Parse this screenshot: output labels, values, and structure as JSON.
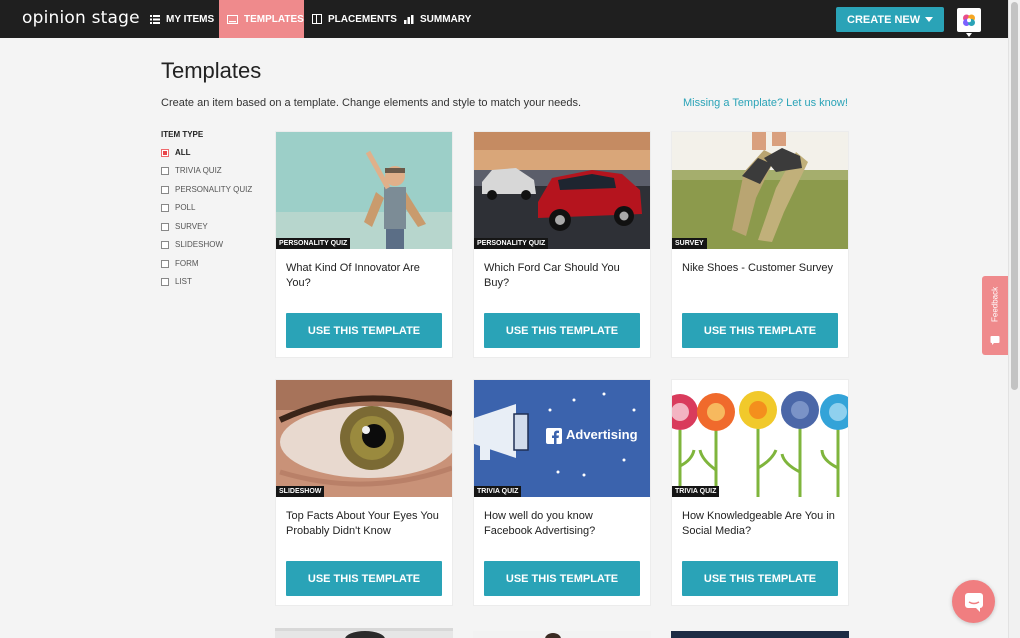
{
  "nav": {
    "logo": "opinion stage",
    "items": [
      {
        "label": "My Items",
        "icon": "list-icon"
      },
      {
        "label": "Templates",
        "icon": "template-icon"
      },
      {
        "label": "Placements",
        "icon": "placement-icon"
      },
      {
        "label": "Summary",
        "icon": "bar-chart-icon"
      }
    ],
    "create_new": "CREATE NEW"
  },
  "page": {
    "title": "Templates",
    "subtitle": "Create an item based on a template. Change elements and style to match your needs.",
    "missing_link": "Missing a Template? Let us know!"
  },
  "filters": {
    "heading": "ITEM TYPE",
    "items": [
      "ALL",
      "TRIVIA QUIZ",
      "PERSONALITY QUIZ",
      "POLL",
      "SURVEY",
      "SLIDESHOW",
      "FORM",
      "LIST"
    ],
    "selected": "ALL"
  },
  "cards": [
    {
      "tag": "PERSONALITY QUIZ",
      "title": "What Kind Of Innovator Are You?",
      "button": "USE THIS TEMPLATE"
    },
    {
      "tag": "PERSONALITY QUIZ",
      "title": "Which Ford Car Should You Buy?",
      "button": "USE THIS TEMPLATE"
    },
    {
      "tag": "SURVEY",
      "title": "Nike Shoes - Customer Survey",
      "button": "USE THIS TEMPLATE"
    },
    {
      "tag": "SLIDESHOW",
      "title": "Top Facts About Your Eyes You Probably Didn't Know",
      "button": "USE THIS TEMPLATE"
    },
    {
      "tag": "TRIVIA QUIZ",
      "title": "How well do you know Facebook Advertising?",
      "button": "USE THIS TEMPLATE",
      "image_text": "Advertising"
    },
    {
      "tag": "TRIVIA QUIZ",
      "title": "How Knowledgeable Are You in Social Media?",
      "button": "USE THIS TEMPLATE"
    }
  ],
  "feedback": "Feedback",
  "colors": {
    "accent": "#2aa3b7",
    "active_nav": "#ef8a8c",
    "topbar": "#1f1f1f"
  }
}
